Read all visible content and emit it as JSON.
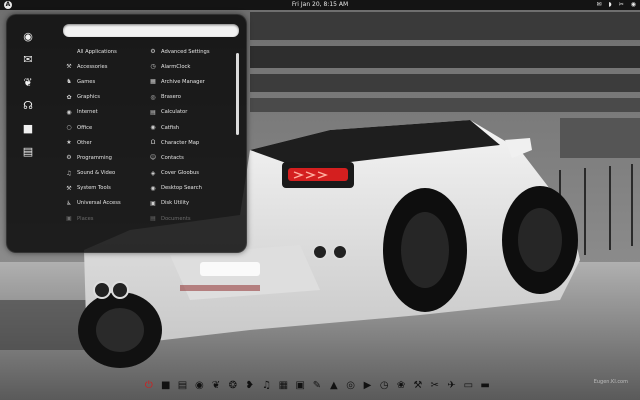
{
  "top_panel": {
    "clock": "Fri Jan 20,  8:15 AM",
    "logo_icon": "A",
    "tray": [
      "✉",
      "◗",
      "✂",
      "◉"
    ]
  },
  "menu": {
    "search": {
      "value": "",
      "placeholder": ""
    },
    "sidebar_icons": [
      {
        "name": "globe-icon",
        "glyph": "◉"
      },
      {
        "name": "mail-icon",
        "glyph": "✉"
      },
      {
        "name": "pidgin-icon",
        "glyph": "❦"
      },
      {
        "name": "headphones-icon",
        "glyph": "☊"
      },
      {
        "name": "terminal-icon",
        "glyph": "■"
      },
      {
        "name": "documents-icon",
        "glyph": "▤"
      }
    ],
    "categories": [
      {
        "label": "All Applications",
        "icon": ""
      },
      {
        "label": "Accessories",
        "icon": "⚒"
      },
      {
        "label": "Games",
        "icon": "♞"
      },
      {
        "label": "Graphics",
        "icon": "✿"
      },
      {
        "label": "Internet",
        "icon": "◉"
      },
      {
        "label": "Office",
        "icon": "○"
      },
      {
        "label": "Other",
        "icon": "★"
      },
      {
        "label": "Programming",
        "icon": "⚙"
      },
      {
        "label": "Sound & Video",
        "icon": "♫"
      },
      {
        "label": "System Tools",
        "icon": "⚒"
      },
      {
        "label": "Universal Access",
        "icon": "♿"
      },
      {
        "label": "Places",
        "icon": "▣"
      }
    ],
    "apps": [
      {
        "label": "Advanced Settings",
        "icon": "⚙"
      },
      {
        "label": "AlarmClock",
        "icon": "◷"
      },
      {
        "label": "Archive Manager",
        "icon": "▦"
      },
      {
        "label": "Brasero",
        "icon": "◎"
      },
      {
        "label": "Calculator",
        "icon": "▤"
      },
      {
        "label": "Catfish",
        "icon": "◉"
      },
      {
        "label": "Character Map",
        "icon": "Ω"
      },
      {
        "label": "Contacts",
        "icon": "☺"
      },
      {
        "label": "Cover Gloobus",
        "icon": "◈"
      },
      {
        "label": "Desktop Search",
        "icon": "◉"
      },
      {
        "label": "Disk Utility",
        "icon": "▣"
      },
      {
        "label": "Documents",
        "icon": "▤"
      }
    ]
  },
  "dock": [
    {
      "name": "power-icon",
      "glyph": "⏻"
    },
    {
      "name": "terminal-icon",
      "glyph": "■"
    },
    {
      "name": "files-icon",
      "glyph": "▤"
    },
    {
      "name": "browser-icon",
      "glyph": "◉"
    },
    {
      "name": "bird-icon",
      "glyph": "❦"
    },
    {
      "name": "firefox-icon",
      "glyph": "❂"
    },
    {
      "name": "chat-icon",
      "glyph": "❥"
    },
    {
      "name": "music-icon",
      "glyph": "♫"
    },
    {
      "name": "calculator-icon",
      "glyph": "▦"
    },
    {
      "name": "toolbox-icon",
      "glyph": "▣"
    },
    {
      "name": "pen-icon",
      "glyph": "✎"
    },
    {
      "name": "vlc-icon",
      "glyph": "▲"
    },
    {
      "name": "disc-icon",
      "glyph": "◎"
    },
    {
      "name": "player-icon",
      "glyph": "▶"
    },
    {
      "name": "clock-icon",
      "glyph": "◷"
    },
    {
      "name": "gnome-icon",
      "glyph": "❀"
    },
    {
      "name": "tools-icon",
      "glyph": "⚒"
    },
    {
      "name": "settings-icon",
      "glyph": "✂"
    },
    {
      "name": "plane-icon",
      "glyph": "✈"
    },
    {
      "name": "monitor-icon",
      "glyph": "▭"
    },
    {
      "name": "trash-icon",
      "glyph": "▬"
    }
  ],
  "watermark": "Eugen.Kl.com"
}
